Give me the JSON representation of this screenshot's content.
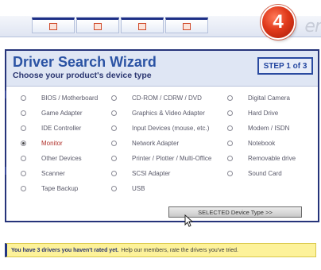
{
  "step_number": "4",
  "wordmark": "er",
  "wizard": {
    "title": "Driver Search Wizard",
    "subtitle": "Choose your product's device type",
    "step_badge": "STEP 1 of 3",
    "selected_button": "SELECTED Device Type >>"
  },
  "options": [
    {
      "label": "BIOS / Motherboard",
      "checked": false
    },
    {
      "label": "CD-ROM / CDRW / DVD",
      "checked": false
    },
    {
      "label": "Digital Camera",
      "checked": false
    },
    {
      "label": "Game Adapter",
      "checked": false
    },
    {
      "label": "Graphics & Video Adapter",
      "checked": false
    },
    {
      "label": "Hard Drive",
      "checked": false
    },
    {
      "label": "IDE Controller",
      "checked": false
    },
    {
      "label": "Input Devices (mouse, etc.)",
      "checked": false
    },
    {
      "label": "Modem / ISDN",
      "checked": false
    },
    {
      "label": "Monitor",
      "checked": true
    },
    {
      "label": "Network Adapter",
      "checked": false
    },
    {
      "label": "Notebook",
      "checked": false
    },
    {
      "label": "Other Devices",
      "checked": false
    },
    {
      "label": "Printer / Plotter / Multi-Office",
      "checked": false
    },
    {
      "label": "Removable drive",
      "checked": false
    },
    {
      "label": "Scanner",
      "checked": false
    },
    {
      "label": "SCSI Adapter",
      "checked": false
    },
    {
      "label": "Sound Card",
      "checked": false
    },
    {
      "label": "Tape Backup",
      "checked": false
    },
    {
      "label": "USB",
      "checked": false
    }
  ],
  "notice": {
    "bold": "You have 3 drivers you haven't rated yet.",
    "text": "Help our members, rate the drivers you've tried."
  },
  "colors": {
    "accent": "#2b53a4",
    "panel_border": "#26347a",
    "selected_text": "#b0302a",
    "notice_bg": "#fdf29a",
    "badge_red": "#e03a1c"
  }
}
